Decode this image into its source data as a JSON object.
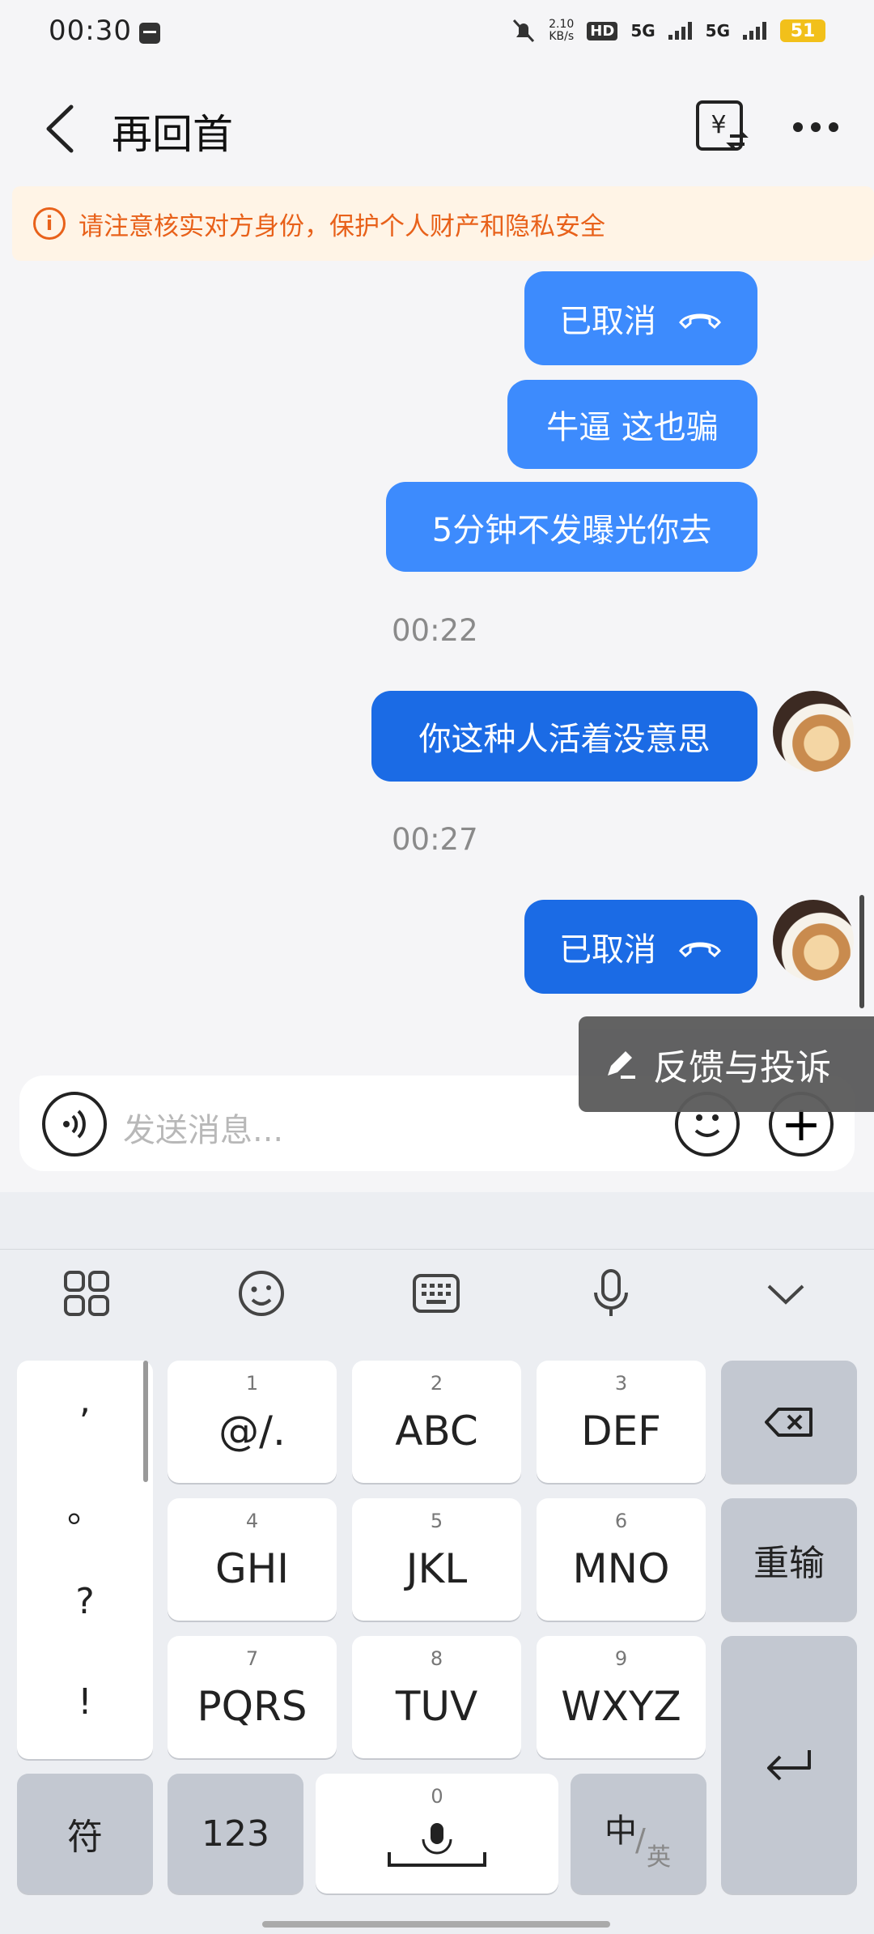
{
  "status": {
    "time": "00:30",
    "speed": "2.10",
    "speed_unit": "KB/s",
    "hd": "HD",
    "net1": "5G",
    "net2": "5G",
    "battery": "51"
  },
  "header": {
    "title": "再回首"
  },
  "warning": {
    "text": "请注意核实对方身份，保护个人财产和隐私安全"
  },
  "messages": [
    {
      "text": "已取消"
    },
    {
      "text": "牛逼 这也骗"
    },
    {
      "text": "5分钟不发曝光你去"
    },
    {
      "time": "00:22"
    },
    {
      "text": "你这种人活着没意思"
    },
    {
      "time": "00:27"
    },
    {
      "text": "已取消"
    }
  ],
  "feedback": {
    "label": "反馈与投诉"
  },
  "input": {
    "placeholder": "发送消息..."
  },
  "keyboard": {
    "punct": [
      ",",
      "。",
      "?",
      "!"
    ],
    "keys": [
      {
        "num": "1",
        "label": "@/."
      },
      {
        "num": "2",
        "label": "ABC"
      },
      {
        "num": "3",
        "label": "DEF"
      },
      {
        "num": "4",
        "label": "GHI"
      },
      {
        "num": "5",
        "label": "JKL"
      },
      {
        "num": "6",
        "label": "MNO"
      },
      {
        "num": "7",
        "label": "PQRS"
      },
      {
        "num": "8",
        "label": "TUV"
      },
      {
        "num": "9",
        "label": "WXYZ"
      }
    ],
    "reenter": "重输",
    "symbol": "符",
    "numbers": "123",
    "space_num": "0",
    "lang_main": "中",
    "lang_sub": "英"
  },
  "colors": {
    "bubble": "#3d8bfd",
    "bubble_dark": "#1b6be5",
    "warning": "#e8611a"
  }
}
